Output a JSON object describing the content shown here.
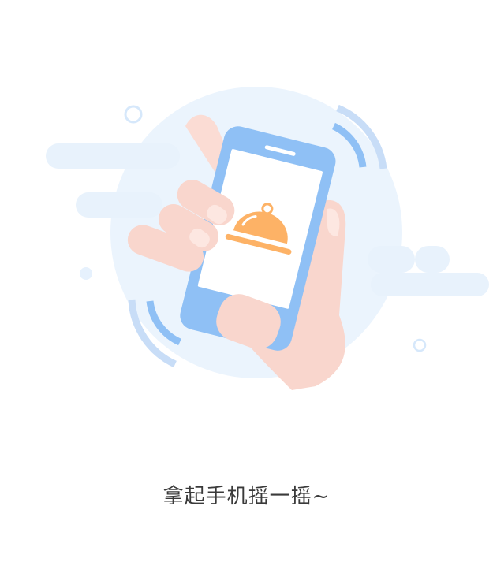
{
  "instruction": {
    "text": "拿起手机摇一摇~"
  },
  "icons": {
    "hand": "hand-icon",
    "phone": "phone-icon",
    "dish": "serving-dish-icon",
    "shake_waves": "shake-wave-icon"
  },
  "colors": {
    "background_circle": "#ebf4fd",
    "cloud": "#e8f2fc",
    "phone_frame": "#8fc0f5",
    "phone_screen": "#ffffff",
    "dish": "#fdb266",
    "hand": "#f9d6cd",
    "text": "#3a3a3a"
  }
}
